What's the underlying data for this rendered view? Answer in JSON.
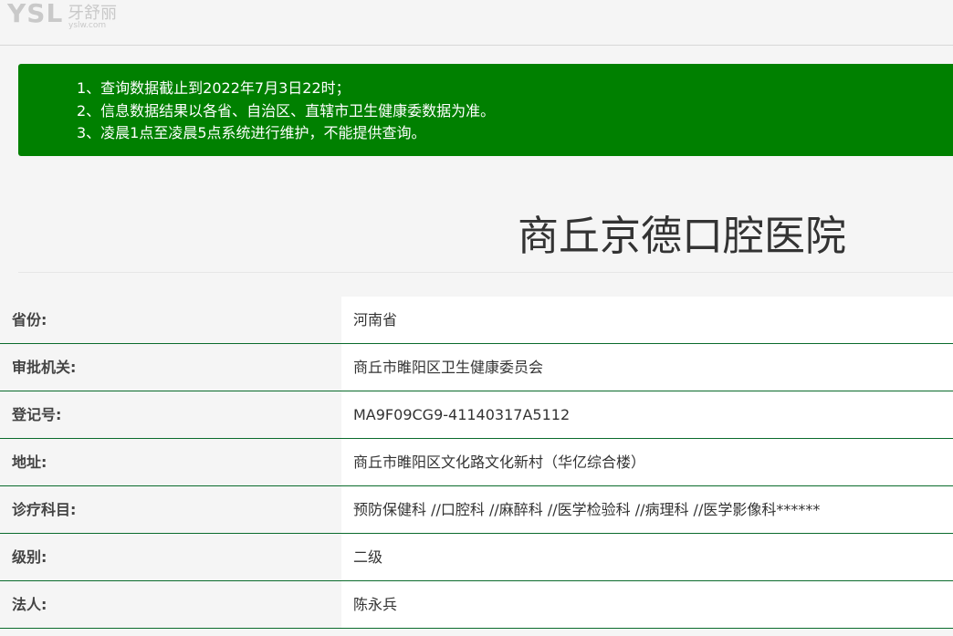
{
  "logo": {
    "mark": "YSL",
    "name": "牙舒丽",
    "url": "yslw.com"
  },
  "notice": {
    "lines": [
      "1、查询数据截止到2022年7月3日22时；",
      "2、信息数据结果以各省、自治区、直辖市卫生健康委数据为准。",
      "3、凌晨1点至凌晨5点系统进行维护，不能提供查询。"
    ]
  },
  "hospital": {
    "name": "商丘京德口腔医院"
  },
  "info": {
    "rows": [
      {
        "label": "省份:",
        "value": "河南省"
      },
      {
        "label": "审批机关:",
        "value": "商丘市睢阳区卫生健康委员会"
      },
      {
        "label": "登记号:",
        "value": "MA9F09CG9-41140317A5112"
      },
      {
        "label": "地址:",
        "value": "商丘市睢阳区文化路文化新村（华亿综合楼）"
      },
      {
        "label": "诊疗科目:",
        "value": "预防保健科 //口腔科 //麻醉科 //医学检验科 //病理科 //医学影像科******"
      },
      {
        "label": "级别:",
        "value": "二级"
      },
      {
        "label": "法人:",
        "value": "陈永兵"
      }
    ]
  }
}
